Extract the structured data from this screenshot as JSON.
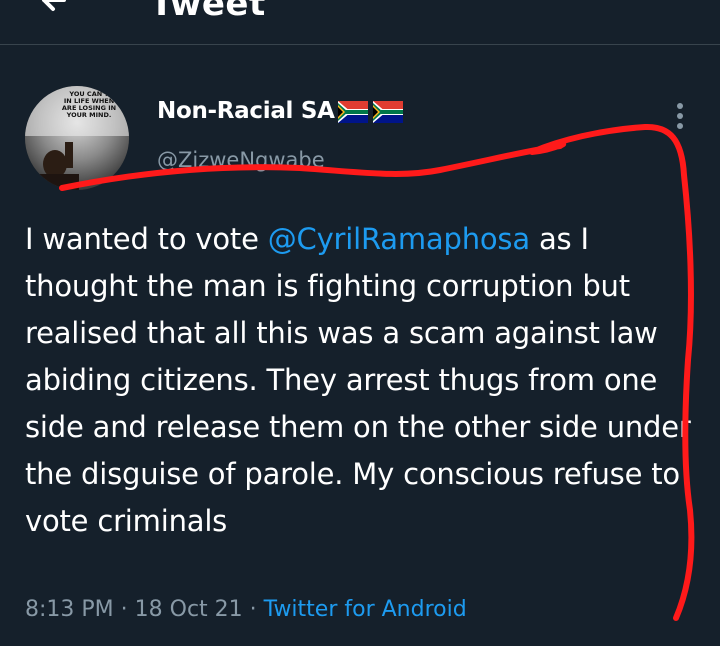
{
  "header": {
    "title": "Tweet",
    "back_icon": "arrow-left-icon"
  },
  "author": {
    "display_name": "Non-Racial SA",
    "handle": "@ZizweNgwabe",
    "flag_icons": [
      "south-africa-flag-icon",
      "south-africa-flag-icon"
    ],
    "avatar_caption": [
      "YOU CAN'T",
      "IN LIFE WHEN",
      "ARE LOSING IN",
      "YOUR MIND."
    ]
  },
  "tweet": {
    "text_before": "I wanted to vote ",
    "mention": "@CyrilRamaphosa",
    "text_after": " as I thought the man is fighting corruption but realised that all this was a scam against law abiding citizens. They arrest thugs from one side and release them on the other side under the disguise of parole. My conscious refuse to vote criminals"
  },
  "meta": {
    "time": "8:13 PM",
    "separator": " · ",
    "date": "18 Oct 21",
    "source": "Twitter for Android"
  },
  "colors": {
    "background": "#15202b",
    "accent": "#1d9bf0",
    "secondary_text": "#8899a6",
    "annotation": "#ff1a1a"
  }
}
